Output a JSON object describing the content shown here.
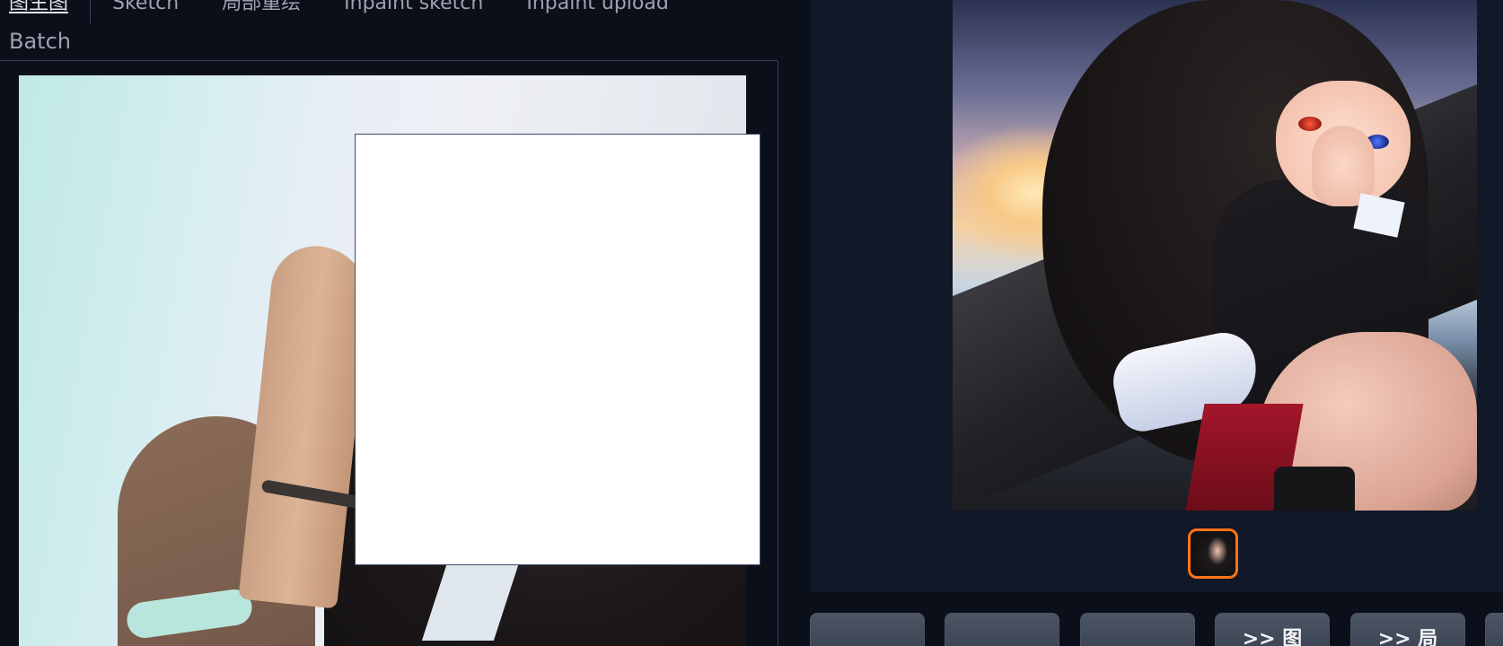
{
  "tabs": {
    "items": [
      {
        "label": "图生图",
        "active": true
      },
      {
        "label": "Sketch",
        "active": false
      },
      {
        "label": "局部重绘",
        "active": false
      },
      {
        "label": "Inpaint sketch",
        "active": false
      },
      {
        "label": "Inpaint upload",
        "active": false
      }
    ],
    "batch_label": "Batch"
  },
  "gallery": {
    "selected_thumbnail": 1,
    "accent_color": "#f97316"
  },
  "action_buttons": [
    {
      "label": ""
    },
    {
      "label": ""
    },
    {
      "label": ""
    },
    {
      "label": ">> 图"
    },
    {
      "label": ">> 局"
    }
  ],
  "colors": {
    "background": "#0b0f19",
    "panel": "#111827",
    "button": "#4b5563",
    "mask": "#ffffff"
  }
}
